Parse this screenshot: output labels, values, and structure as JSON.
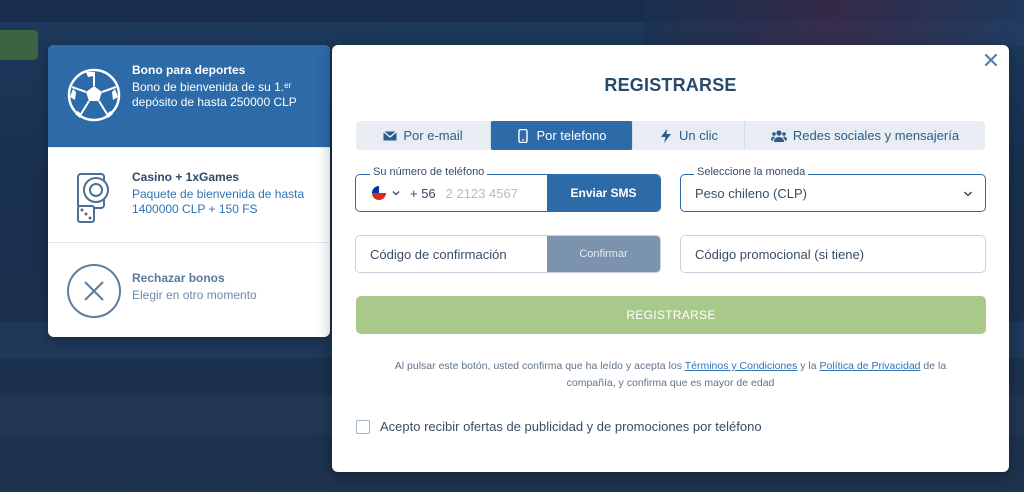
{
  "bonus_panel": {
    "items": [
      {
        "title": "Bono para deportes",
        "desc": "Bono de bienvenida de su 1.ᵉʳ depósito de hasta 250000 CLP",
        "icon": "soccer-ball-icon",
        "selected": true
      },
      {
        "title": "Casino + 1xGames",
        "desc": "Paquete de bienvenida de hasta 1400000 CLP + 150 FS",
        "icon": "casino-chips-icon",
        "selected": false
      },
      {
        "title": "Rechazar bonos",
        "desc": "Elegir en otro momento",
        "icon": "close-circle-icon",
        "selected": false
      }
    ]
  },
  "modal": {
    "title": "REGISTRARSE",
    "close": "✕",
    "tabs": [
      {
        "label": "Por e-mail",
        "icon": "envelope-icon",
        "active": false
      },
      {
        "label": "Por telefono",
        "icon": "phone-icon",
        "active": true
      },
      {
        "label": "Un clic",
        "icon": "lightning-icon",
        "active": false
      },
      {
        "label": "Redes sociales y mensajería",
        "icon": "users-icon",
        "active": false
      }
    ],
    "phone": {
      "label": "Su número de teléfono",
      "prefix": "+ 56",
      "placeholder": "2 2123 4567",
      "send_sms": "Enviar SMS",
      "country": "chile-flag-icon"
    },
    "currency": {
      "label": "Seleccione la moneda",
      "value": "Peso chileno (CLP)"
    },
    "code": {
      "placeholder": "Código de confirmación",
      "confirm": "Confirmar"
    },
    "promo": {
      "placeholder": "Código promocional (si tiene)"
    },
    "register_button": "REGISTRARSE",
    "terms": {
      "pre": "Al pulsar este botón, usted confirma que ha leído y acepta los ",
      "terms_link": "Términos y Condiciones",
      "mid": " y la ",
      "privacy_link": "Política de Privacidad",
      "post": " de la compañía, y confirma que es mayor de edad"
    },
    "consent": "Acepto recibir ofertas de publicidad y de promociones por teléfono"
  },
  "colors": {
    "primary": "#2c6aa8",
    "register_disabled": "#a9c98a",
    "confirm_disabled": "#7b93ad"
  }
}
